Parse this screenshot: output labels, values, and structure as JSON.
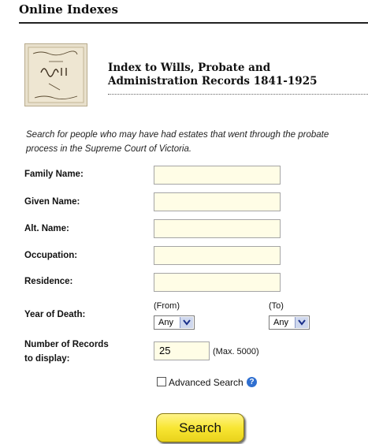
{
  "header": {
    "title": "Online Indexes"
  },
  "index": {
    "title": "Index to Wills, Probate and Administration Records 1841-1925"
  },
  "intro": "Search for people who may have had estates that went through the probate process in the Supreme Court of Victoria.",
  "form": {
    "family_name": {
      "label": "Family Name:",
      "value": ""
    },
    "given_name": {
      "label": "Given Name:",
      "value": ""
    },
    "alt_name": {
      "label": "Alt. Name:",
      "value": ""
    },
    "occupation": {
      "label": "Occupation:",
      "value": ""
    },
    "residence": {
      "label": "Residence:",
      "value": ""
    },
    "year_of_death": {
      "label": "Year of Death:",
      "from_label": "(From)",
      "to_label": "(To)",
      "from_value": "Any",
      "to_value": "Any"
    },
    "records": {
      "label_line1": "Number of Records",
      "label_line2": "to display:",
      "value": "25",
      "max_note": "(Max. 5000)"
    },
    "advanced_search": {
      "label": "Advanced Search",
      "checked": false
    },
    "search_button": "Search"
  },
  "icons": {
    "help": "help-icon",
    "thumbnail": "will-document-thumbnail",
    "dropdown": "chevron-down-icon"
  },
  "colors": {
    "input_bg": "#fffde6",
    "button_yellow": "#f8e633",
    "select_arrow_bg": "#cfd8ee",
    "help_blue": "#2f6fd0"
  }
}
